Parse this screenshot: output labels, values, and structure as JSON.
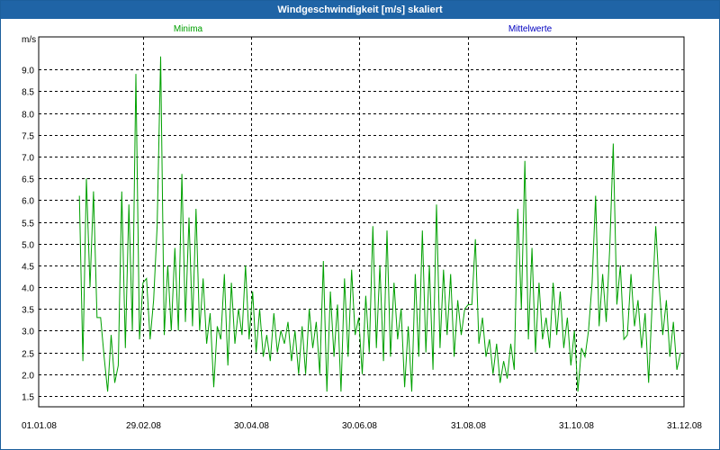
{
  "window": {
    "title": "Windgeschwindigkeit [m/s] skaliert"
  },
  "legend": {
    "series_a": "Minima",
    "series_b": "Mittelwerte"
  },
  "colors": {
    "series_a": "#00a000",
    "series_b": "#0000c0",
    "title_bar": "#1f64a6"
  },
  "chart_data": {
    "type": "line",
    "title": "Windgeschwindigkeit [m/s] skaliert",
    "ylabel": "m/s",
    "xlabel": "",
    "ylim": [
      1.25,
      9.75
    ],
    "x_start": "2008-01-01",
    "x_end": "2008-12-31",
    "y_ticks": [
      "1.5",
      "2.0",
      "2.5",
      "3.0",
      "3.5",
      "4.0",
      "4.5",
      "5.0",
      "5.5",
      "6.0",
      "6.5",
      "7.0",
      "7.5",
      "8.0",
      "8.5",
      "9.0"
    ],
    "x_ticks": [
      {
        "date": "2008-01-01",
        "label": "01.01.08"
      },
      {
        "date": "2008-02-29",
        "label": "29.02.08"
      },
      {
        "date": "2008-04-30",
        "label": "30.04.08"
      },
      {
        "date": "2008-06-30",
        "label": "30.06.08"
      },
      {
        "date": "2008-08-31",
        "label": "31.08.08"
      },
      {
        "date": "2008-10-31",
        "label": "31.10.08"
      },
      {
        "date": "2008-12-31",
        "label": "31.12.08"
      }
    ],
    "grid": true,
    "series": [
      {
        "name": "Minima",
        "color": "#00a000",
        "points": [
          [
            "2008-01-24",
            6.1
          ],
          [
            "2008-01-26",
            2.3
          ],
          [
            "2008-01-28",
            6.5
          ],
          [
            "2008-01-30",
            4.0
          ],
          [
            "2008-02-01",
            6.2
          ],
          [
            "2008-02-03",
            3.3
          ],
          [
            "2008-02-05",
            3.3
          ],
          [
            "2008-02-07",
            2.4
          ],
          [
            "2008-02-09",
            1.6
          ],
          [
            "2008-02-11",
            2.9
          ],
          [
            "2008-02-13",
            1.8
          ],
          [
            "2008-02-15",
            2.2
          ],
          [
            "2008-02-17",
            6.2
          ],
          [
            "2008-02-19",
            2.6
          ],
          [
            "2008-02-21",
            5.9
          ],
          [
            "2008-02-23",
            3.0
          ],
          [
            "2008-02-25",
            8.9
          ],
          [
            "2008-02-27",
            2.8
          ],
          [
            "2008-02-29",
            4.1
          ],
          [
            "2008-03-02",
            4.2
          ],
          [
            "2008-03-04",
            2.8
          ],
          [
            "2008-03-06",
            3.7
          ],
          [
            "2008-03-08",
            5.4
          ],
          [
            "2008-03-10",
            9.3
          ],
          [
            "2008-03-12",
            2.9
          ],
          [
            "2008-03-14",
            4.5
          ],
          [
            "2008-03-16",
            3.0
          ],
          [
            "2008-03-18",
            4.9
          ],
          [
            "2008-03-20",
            3.0
          ],
          [
            "2008-03-22",
            6.6
          ],
          [
            "2008-03-24",
            3.2
          ],
          [
            "2008-03-26",
            5.6
          ],
          [
            "2008-03-28",
            3.1
          ],
          [
            "2008-03-30",
            5.8
          ],
          [
            "2008-04-01",
            3.0
          ],
          [
            "2008-04-03",
            4.2
          ],
          [
            "2008-04-05",
            2.7
          ],
          [
            "2008-04-07",
            3.4
          ],
          [
            "2008-04-09",
            1.7
          ],
          [
            "2008-04-11",
            3.1
          ],
          [
            "2008-04-13",
            2.8
          ],
          [
            "2008-04-15",
            4.3
          ],
          [
            "2008-04-17",
            2.2
          ],
          [
            "2008-04-19",
            4.1
          ],
          [
            "2008-04-21",
            2.7
          ],
          [
            "2008-04-23",
            3.5
          ],
          [
            "2008-04-25",
            2.9
          ],
          [
            "2008-04-27",
            4.5
          ],
          [
            "2008-04-29",
            2.8
          ],
          [
            "2008-05-01",
            3.9
          ],
          [
            "2008-05-03",
            2.5
          ],
          [
            "2008-05-05",
            3.5
          ],
          [
            "2008-05-07",
            2.4
          ],
          [
            "2008-05-09",
            2.9
          ],
          [
            "2008-05-11",
            2.3
          ],
          [
            "2008-05-13",
            3.4
          ],
          [
            "2008-05-15",
            2.5
          ],
          [
            "2008-05-17",
            3.0
          ],
          [
            "2008-05-19",
            2.7
          ],
          [
            "2008-05-21",
            3.2
          ],
          [
            "2008-05-23",
            2.3
          ],
          [
            "2008-05-25",
            3.0
          ],
          [
            "2008-05-27",
            2.0
          ],
          [
            "2008-05-29",
            3.1
          ],
          [
            "2008-05-31",
            2.0
          ],
          [
            "2008-06-02",
            3.5
          ],
          [
            "2008-06-04",
            2.6
          ],
          [
            "2008-06-06",
            3.2
          ],
          [
            "2008-06-08",
            2.0
          ],
          [
            "2008-06-10",
            4.6
          ],
          [
            "2008-06-12",
            1.6
          ],
          [
            "2008-06-14",
            3.9
          ],
          [
            "2008-06-16",
            2.4
          ],
          [
            "2008-06-18",
            3.6
          ],
          [
            "2008-06-20",
            1.6
          ],
          [
            "2008-06-22",
            4.2
          ],
          [
            "2008-06-24",
            2.4
          ],
          [
            "2008-06-26",
            4.4
          ],
          [
            "2008-06-28",
            2.9
          ],
          [
            "2008-06-30",
            3.3
          ],
          [
            "2008-07-02",
            2.0
          ],
          [
            "2008-07-04",
            3.8
          ],
          [
            "2008-07-06",
            2.5
          ],
          [
            "2008-07-08",
            5.4
          ],
          [
            "2008-07-10",
            2.6
          ],
          [
            "2008-07-12",
            4.5
          ],
          [
            "2008-07-14",
            2.3
          ],
          [
            "2008-07-16",
            5.3
          ],
          [
            "2008-07-18",
            2.4
          ],
          [
            "2008-07-20",
            4.1
          ],
          [
            "2008-07-22",
            2.8
          ],
          [
            "2008-07-24",
            3.5
          ],
          [
            "2008-07-26",
            1.7
          ],
          [
            "2008-07-28",
            3.1
          ],
          [
            "2008-07-30",
            1.6
          ],
          [
            "2008-08-01",
            4.3
          ],
          [
            "2008-08-03",
            2.4
          ],
          [
            "2008-08-05",
            5.3
          ],
          [
            "2008-08-07",
            2.5
          ],
          [
            "2008-08-09",
            4.5
          ],
          [
            "2008-08-11",
            2.1
          ],
          [
            "2008-08-13",
            5.9
          ],
          [
            "2008-08-15",
            2.6
          ],
          [
            "2008-08-17",
            4.4
          ],
          [
            "2008-08-19",
            2.9
          ],
          [
            "2008-08-21",
            4.3
          ],
          [
            "2008-08-23",
            2.4
          ],
          [
            "2008-08-25",
            3.7
          ],
          [
            "2008-08-27",
            2.9
          ],
          [
            "2008-08-29",
            3.5
          ],
          [
            "2008-08-31",
            3.6
          ],
          [
            "2008-09-02",
            3.6
          ],
          [
            "2008-09-04",
            5.1
          ],
          [
            "2008-09-06",
            2.7
          ],
          [
            "2008-09-08",
            3.3
          ],
          [
            "2008-09-10",
            2.4
          ],
          [
            "2008-09-12",
            2.8
          ],
          [
            "2008-09-14",
            2.0
          ],
          [
            "2008-09-16",
            2.7
          ],
          [
            "2008-09-18",
            1.8
          ],
          [
            "2008-09-20",
            2.3
          ],
          [
            "2008-09-22",
            1.9
          ],
          [
            "2008-09-24",
            2.7
          ],
          [
            "2008-09-26",
            2.1
          ],
          [
            "2008-09-28",
            5.8
          ],
          [
            "2008-09-30",
            3.5
          ],
          [
            "2008-10-02",
            6.9
          ],
          [
            "2008-10-04",
            2.8
          ],
          [
            "2008-10-06",
            4.9
          ],
          [
            "2008-10-08",
            2.5
          ],
          [
            "2008-10-10",
            4.1
          ],
          [
            "2008-10-12",
            2.8
          ],
          [
            "2008-10-14",
            3.3
          ],
          [
            "2008-10-16",
            2.6
          ],
          [
            "2008-10-18",
            4.1
          ],
          [
            "2008-10-20",
            2.9
          ],
          [
            "2008-10-22",
            3.9
          ],
          [
            "2008-10-24",
            2.6
          ],
          [
            "2008-10-26",
            3.3
          ],
          [
            "2008-10-28",
            2.2
          ],
          [
            "2008-10-30",
            3.0
          ],
          [
            "2008-11-01",
            1.6
          ],
          [
            "2008-11-03",
            2.6
          ],
          [
            "2008-11-05",
            2.4
          ],
          [
            "2008-11-07",
            3.0
          ],
          [
            "2008-11-09",
            4.1
          ],
          [
            "2008-11-11",
            6.1
          ],
          [
            "2008-11-13",
            3.1
          ],
          [
            "2008-11-15",
            4.3
          ],
          [
            "2008-11-17",
            3.2
          ],
          [
            "2008-11-19",
            4.9
          ],
          [
            "2008-11-21",
            7.3
          ],
          [
            "2008-11-23",
            3.6
          ],
          [
            "2008-11-25",
            4.5
          ],
          [
            "2008-11-27",
            2.8
          ],
          [
            "2008-11-29",
            2.9
          ],
          [
            "2008-12-01",
            4.3
          ],
          [
            "2008-12-03",
            3.1
          ],
          [
            "2008-12-05",
            3.7
          ],
          [
            "2008-12-07",
            2.6
          ],
          [
            "2008-12-09",
            3.4
          ],
          [
            "2008-12-11",
            1.8
          ],
          [
            "2008-12-13",
            3.6
          ],
          [
            "2008-12-15",
            5.4
          ],
          [
            "2008-12-17",
            4.0
          ],
          [
            "2008-12-19",
            2.9
          ],
          [
            "2008-12-21",
            3.7
          ],
          [
            "2008-12-23",
            2.4
          ],
          [
            "2008-12-25",
            3.2
          ],
          [
            "2008-12-27",
            2.1
          ],
          [
            "2008-12-29",
            2.5
          ]
        ]
      }
    ]
  }
}
